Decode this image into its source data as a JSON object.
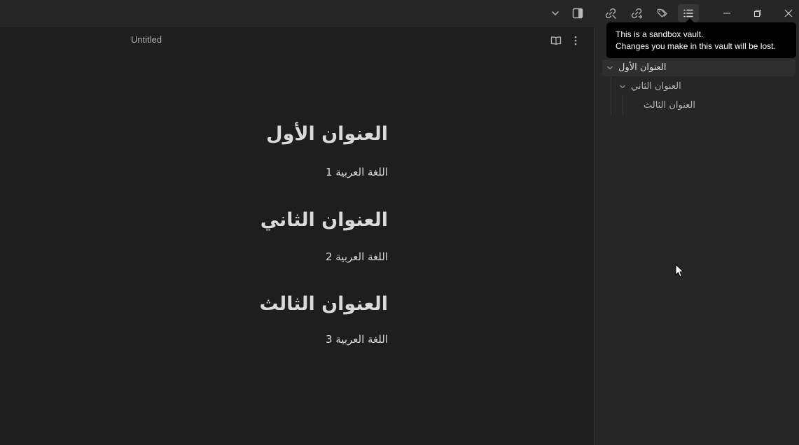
{
  "titlebar": {
    "icons": [
      "chevron-down-icon",
      "sidebar-toggle-icon",
      "unlinked-mentions-icon",
      "outgoing-links-icon",
      "tags-icon",
      "outline-icon"
    ],
    "window_controls": [
      "minimize-icon",
      "restore-icon",
      "close-icon"
    ]
  },
  "editor": {
    "tab_title": "Untitled",
    "actions": [
      "reading-view-icon",
      "more-options-icon"
    ],
    "content": [
      {
        "type": "h1",
        "text": "العنوان الأول"
      },
      {
        "type": "p",
        "text": "اللغة العربية 1"
      },
      {
        "type": "h1",
        "text": "العنوان الثاني"
      },
      {
        "type": "p",
        "text": "اللغة العربية 2"
      },
      {
        "type": "h1",
        "text": "العنوان الثالث"
      },
      {
        "type": "p",
        "text": "اللغة العربية 3"
      }
    ]
  },
  "outline": {
    "items": [
      {
        "label": "العنوان الأول",
        "level": 1,
        "collapsible": true,
        "selected": true
      },
      {
        "label": "العنوان الثاني",
        "level": 2,
        "collapsible": true,
        "selected": false
      },
      {
        "label": "العنوان الثالث",
        "level": 3,
        "collapsible": false,
        "selected": false
      }
    ]
  },
  "tooltip": {
    "line1": "This is a sandbox vault.",
    "line2": "Changes you make in this vault will be lost."
  },
  "colors": {
    "editor_bg": "#1e1e1e",
    "sidebar_bg": "#262626",
    "titlebar_bg": "#262626",
    "text": "#dadada",
    "muted": "#b3b3b3",
    "tooltip_bg": "#000000"
  }
}
